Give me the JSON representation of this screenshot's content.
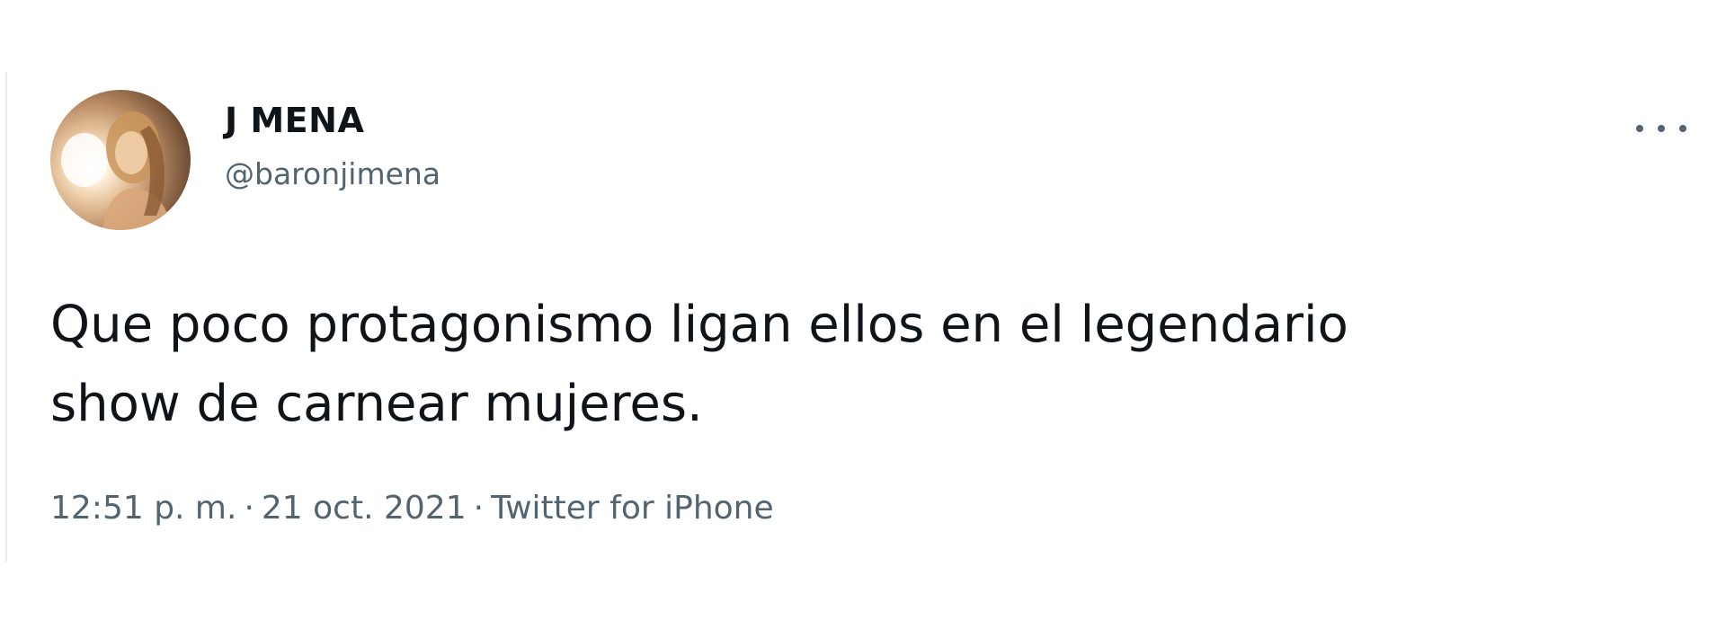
{
  "user": {
    "display_name": "Ј MENA",
    "handle": "@baronjimena",
    "avatar_icon": "profile-photo"
  },
  "menu": {
    "icon": "more-horizontal-icon"
  },
  "tweet": {
    "text_lines": [
      "Que poco protagonismo ligan ellos en el legendario",
      "show de carnear mujeres."
    ],
    "time": "12:51 p. m.",
    "date": "21 oct. 2021",
    "separator": "·",
    "source": "Twitter for iPhone"
  },
  "colors": {
    "text_primary": "#0f1419",
    "text_secondary": "#536471",
    "border": "#e9ecee"
  }
}
